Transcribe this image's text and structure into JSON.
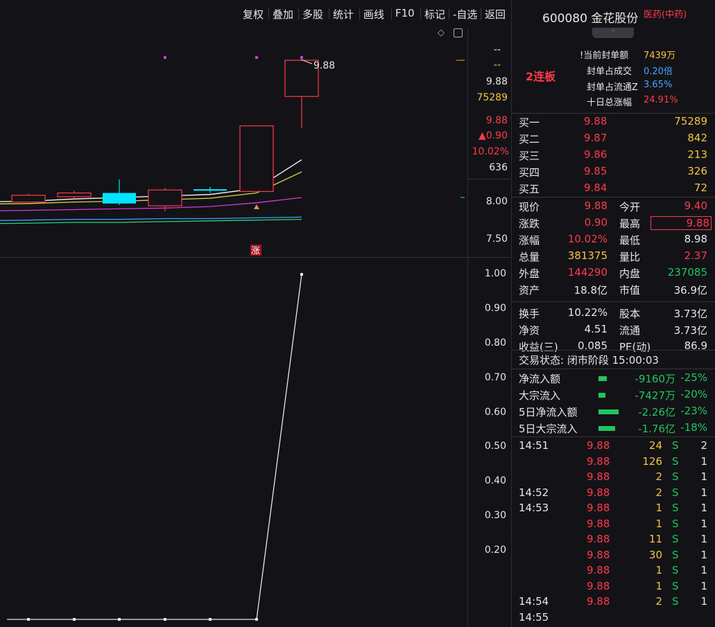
{
  "toolbar": {
    "items": [
      "复权",
      "叠加",
      "多股",
      "统计",
      "画线",
      "F10",
      "标记",
      "-自选",
      "返回"
    ]
  },
  "kline": {
    "price_scale": [
      "9.88",
      "8.00",
      "7.50"
    ],
    "last_high_label": "9.88",
    "marker": "涨",
    "candles": [
      {
        "o": 8.0,
        "c": 8.09,
        "h": 8.11,
        "l": 8.0,
        "dir": "up"
      },
      {
        "o": 8.07,
        "c": 8.12,
        "h": 8.15,
        "l": 8.04,
        "dir": "up"
      },
      {
        "o": 8.12,
        "c": 7.98,
        "h": 8.3,
        "l": 7.96,
        "dir": "down"
      },
      {
        "o": 7.95,
        "c": 8.16,
        "h": 8.19,
        "l": 7.88,
        "dir": "up"
      },
      {
        "o": 8.17,
        "c": 8.15,
        "h": 8.2,
        "l": 8.12,
        "dir": "down"
      },
      {
        "o": 8.14,
        "c": 9.01,
        "h": 9.01,
        "l": 8.14,
        "dir": "up"
      },
      {
        "o": 9.4,
        "c": 9.88,
        "h": 9.88,
        "l": 8.98,
        "dir": "up"
      }
    ],
    "ma_colors": [
      "#ffffff",
      "#e5d04a",
      "#d23bd2",
      "#3aa0ff",
      "#2bd47a"
    ]
  },
  "lower": {
    "scale": [
      "1.00",
      "0.90",
      "0.80",
      "0.70",
      "0.60",
      "0.50",
      "0.40",
      "0.30",
      "0.20"
    ],
    "values": [
      0,
      0,
      0,
      0,
      0,
      0,
      1.0
    ]
  },
  "info_axis": {
    "dash1": "--",
    "dash2": "--",
    "price": "9.88",
    "vol": "75289",
    "cur": "9.88",
    "change": "▲0.90",
    "pct": "10.02%",
    "amount": "636"
  },
  "stock": {
    "code_name": "600080 金花股份",
    "sector": "医药(中药)",
    "lianban": "2连板",
    "seal": [
      {
        "label": "当前封单额",
        "value": "7439万",
        "prefix": "!"
      },
      {
        "label": "封单占成交",
        "value": "0.20倍",
        "prefix": ""
      },
      {
        "label": "封单占流通Z",
        "value": "3.65%",
        "prefix": ""
      },
      {
        "label": "十日总涨幅",
        "value": "24.91%",
        "prefix": ""
      }
    ]
  },
  "bids": [
    {
      "label": "买一",
      "price": "9.88",
      "vol": "75289"
    },
    {
      "label": "买二",
      "price": "9.87",
      "vol": "842"
    },
    {
      "label": "买三",
      "price": "9.86",
      "vol": "213"
    },
    {
      "label": "买四",
      "price": "9.85",
      "vol": "326"
    },
    {
      "label": "买五",
      "price": "9.84",
      "vol": "72"
    }
  ],
  "quote": [
    {
      "l1": "现价",
      "v1": "9.88",
      "c1": "red",
      "l2": "今开",
      "v2": "9.40",
      "c2": "red"
    },
    {
      "l1": "涨跌",
      "v1": "0.90",
      "c1": "red",
      "l2": "最高",
      "v2": "9.88",
      "c2": "red"
    },
    {
      "l1": "涨幅",
      "v1": "10.02%",
      "c1": "red",
      "l2": "最低",
      "v2": "8.98",
      "c2": "white"
    },
    {
      "l1": "总量",
      "v1": "381375",
      "c1": "yellow",
      "l2": "量比",
      "v2": "2.37",
      "c2": "red"
    },
    {
      "l1": "外盘",
      "v1": "144290",
      "c1": "red",
      "l2": "内盘",
      "v2": "237085",
      "c2": "green"
    },
    {
      "l1": "资产",
      "v1": "18.8亿",
      "c1": "white",
      "l2": "市值",
      "v2": "36.9亿",
      "c2": "white"
    },
    {
      "l1": "换手",
      "v1": "10.22%",
      "c1": "white",
      "l2": "股本",
      "v2": "3.73亿",
      "c2": "white"
    },
    {
      "l1": "净资",
      "v1": "4.51",
      "c1": "white",
      "l2": "流通",
      "v2": "3.73亿",
      "c2": "white"
    },
    {
      "l1": "收益(三)",
      "v1": "0.085",
      "c1": "white",
      "l2": "PE(动)",
      "v2": "86.9",
      "c2": "white"
    }
  ],
  "trade_status": "交易状态: 闭市阶段 15:00:03",
  "flows": [
    {
      "label": "净流入额",
      "value": "-9160万",
      "pct": "-25%",
      "bar": 0.25
    },
    {
      "label": "大宗流入",
      "value": "-7427万",
      "pct": "-20%",
      "bar": 0.2
    },
    {
      "label": "5日净流入额",
      "value": "-2.26亿",
      "pct": "-23%",
      "bar": 0.6
    },
    {
      "label": "5日大宗流入",
      "value": "-1.76亿",
      "pct": "-18%",
      "bar": 0.5
    }
  ],
  "ticks": [
    {
      "time": "14:51",
      "price": "9.88",
      "vol": "24",
      "side": "S",
      "n": "2"
    },
    {
      "time": "",
      "price": "9.88",
      "vol": "126",
      "side": "S",
      "n": "1"
    },
    {
      "time": "",
      "price": "9.88",
      "vol": "2",
      "side": "S",
      "n": "1"
    },
    {
      "time": "14:52",
      "price": "9.88",
      "vol": "2",
      "side": "S",
      "n": "1"
    },
    {
      "time": "14:53",
      "price": "9.88",
      "vol": "1",
      "side": "S",
      "n": "1"
    },
    {
      "time": "",
      "price": "9.88",
      "vol": "1",
      "side": "S",
      "n": "1"
    },
    {
      "time": "",
      "price": "9.88",
      "vol": "11",
      "side": "S",
      "n": "1"
    },
    {
      "time": "",
      "price": "9.88",
      "vol": "30",
      "side": "S",
      "n": "1"
    },
    {
      "time": "",
      "price": "9.88",
      "vol": "1",
      "side": "S",
      "n": "1"
    },
    {
      "time": "",
      "price": "9.88",
      "vol": "1",
      "side": "S",
      "n": "1"
    },
    {
      "time": "14:54",
      "price": "9.88",
      "vol": "2",
      "side": "S",
      "n": "1"
    },
    {
      "time": "14:55",
      "price": "",
      "vol": "",
      "side": "",
      "n": ""
    }
  ],
  "colors": {
    "up": "#ff3a4a",
    "down": "#00e5ff",
    "accent": "#f5c542"
  }
}
